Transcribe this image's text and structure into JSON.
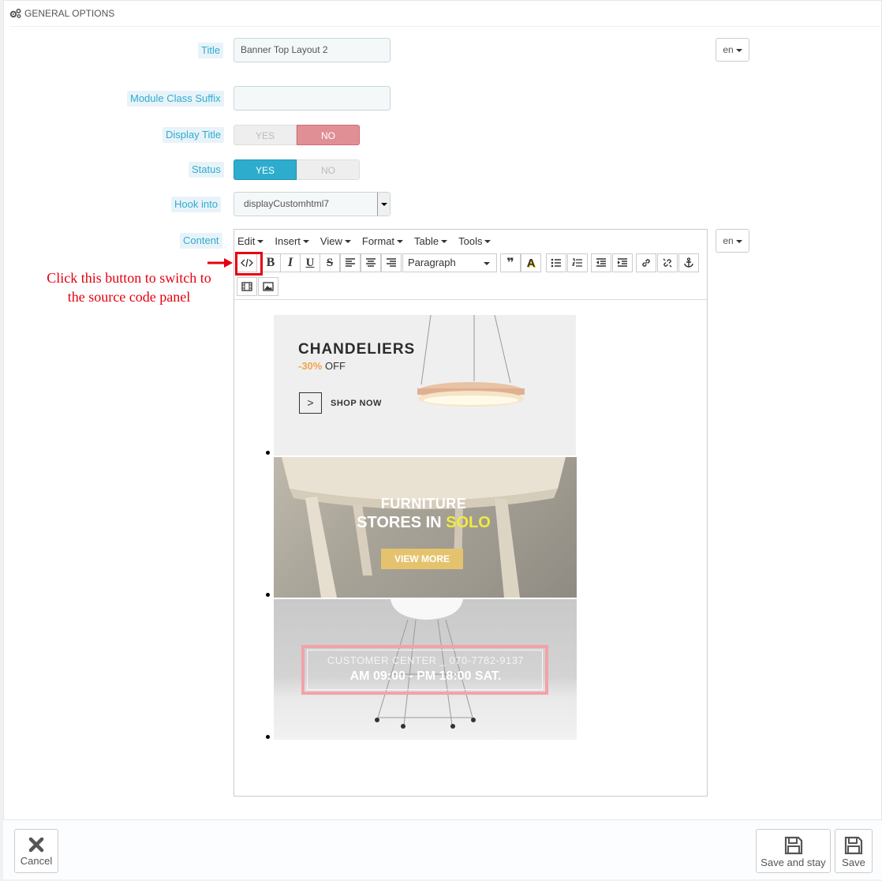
{
  "panel": {
    "heading": "GENERAL OPTIONS",
    "heading_icon": "cogs-icon"
  },
  "form": {
    "title": {
      "label": "Title",
      "value": "Banner Top Layout 2",
      "lang": "en"
    },
    "module_class_suffix": {
      "label": "Module Class Suffix",
      "value": ""
    },
    "display_title": {
      "label": "Display Title",
      "yes": "YES",
      "no": "NO",
      "selected": "NO"
    },
    "status": {
      "label": "Status",
      "yes": "YES",
      "no": "NO",
      "selected": "YES"
    },
    "hook_into": {
      "label": "Hook into",
      "value": "displayCustomhtml7"
    },
    "content": {
      "label": "Content",
      "lang": "en"
    }
  },
  "editor": {
    "menus": [
      "Edit",
      "Insert",
      "View",
      "Format",
      "Table",
      "Tools"
    ],
    "block_format": "Paragraph",
    "toolbar_icons": [
      "source-code-icon",
      "bold-icon",
      "italic-icon",
      "underline-icon",
      "strikethrough-icon",
      "align-left-icon",
      "align-center-icon",
      "align-right-icon",
      "blockquote-icon",
      "text-color-icon",
      "bullet-list-icon",
      "numbered-list-icon",
      "outdent-icon",
      "indent-icon",
      "link-icon",
      "unlink-icon",
      "anchor-icon",
      "media-icon",
      "image-icon"
    ],
    "toolbar_glyphs": {
      "bold": "B",
      "italic": "I",
      "underline": "U",
      "strike": "S",
      "blockquote": "❞",
      "textcolor": "A"
    }
  },
  "annotation": {
    "hint": "Click this button to switch to the source code panel",
    "color": "#e4000f"
  },
  "banners": {
    "chandeliers": {
      "title": "CHANDELIERS",
      "discount": "-30%",
      "off": "OFF",
      "cta": "SHOP NOW",
      "cta_glyph": ">"
    },
    "furniture": {
      "line1": "FURNITURE",
      "line2a": "STORES IN",
      "line2b": "SOLO",
      "cta": "VIEW MORE"
    },
    "customer": {
      "line1": "CUSTOMER CENTER _ 070-7782-9137",
      "line2": "AM 09:00 - PM 18:00 SAT."
    }
  },
  "footer": {
    "cancel": "Cancel",
    "save_and_stay": "Save and stay",
    "save": "Save"
  },
  "colors": {
    "accent": "#2eacce",
    "no_active": "#e08f95",
    "label_bg": "#e8f3f9"
  }
}
